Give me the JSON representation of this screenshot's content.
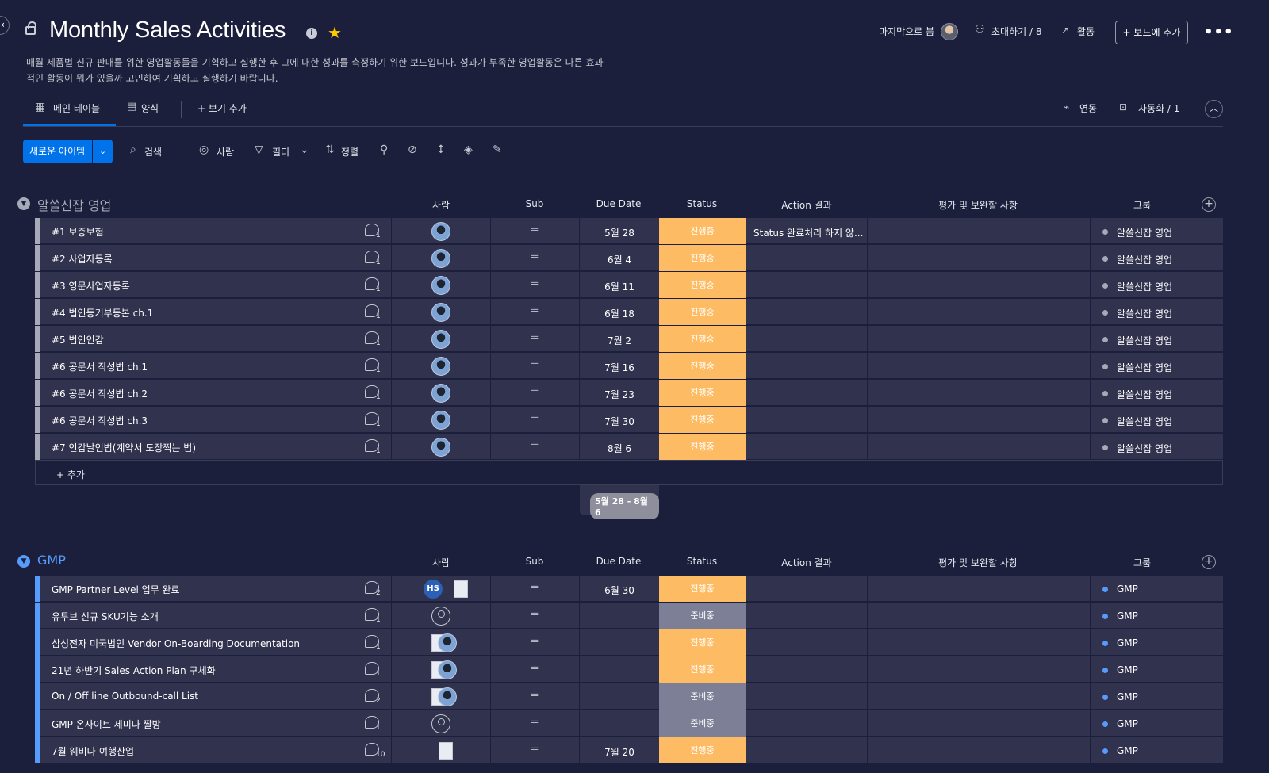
{
  "board": {
    "title": "Monthly Sales Activities",
    "description_line1": "매월 제품별 신규 판매를 위한 영업활동들을 기획하고 실행한 후 그에 대한 성과를 측정하기 위한 보드입니다. 성과가 부족한 영업활동은 다른 효과",
    "description_line2": "적인 활동이 뭐가 있을까 고민하여 기획하고 실행하기 바랍니다."
  },
  "header": {
    "last_seen": "마지막으로 봄",
    "invite": "초대하기 / 8",
    "activity": "활동",
    "add_to_board": "+ 보드에 추가"
  },
  "tabs": {
    "main_table": "메인 테이블",
    "form": "양식",
    "add_view": "+ 보기 추가",
    "integrate": "연동",
    "automate": "자동화 / 1"
  },
  "toolbar": {
    "new_item": "새로운 아이템",
    "search": "검색",
    "person": "사람",
    "filter": "필터",
    "sort": "정렬"
  },
  "columns": {
    "person": "사람",
    "sub": "Sub",
    "due": "Due Date",
    "status": "Status",
    "action": "Action 결과",
    "eval": "평가 및 보완할 사항",
    "group": "그룹"
  },
  "groups": [
    {
      "name": "알쓸신잡 영업",
      "color": "#a6a9b8",
      "add_label": "+ 추가",
      "date_range": "5월 28 - 8월 6",
      "rows": [
        {
          "name": "#1 보증보험",
          "updates": "1",
          "due": "5월 28",
          "status": "진행중",
          "action": "Status 완료처리 하지 않...",
          "group": "알쓸신잡 영업"
        },
        {
          "name": "#2 사업자등록",
          "updates": "1",
          "due": "6월 4",
          "status": "진행중",
          "action": "",
          "group": "알쓸신잡 영업"
        },
        {
          "name": "#3 영문사업자등록",
          "updates": "1",
          "due": "6월 11",
          "status": "진행중",
          "action": "",
          "group": "알쓸신잡 영업"
        },
        {
          "name": "#4 법인등기부등본 ch.1",
          "updates": "1",
          "due": "6월 18",
          "status": "진행중",
          "action": "",
          "group": "알쓸신잡 영업"
        },
        {
          "name": "#5 법인인감",
          "updates": "1",
          "due": "7월 2",
          "status": "진행중",
          "action": "",
          "group": "알쓸신잡 영업"
        },
        {
          "name": "#6 공문서 작성법 ch.1",
          "updates": "1",
          "due": "7월 16",
          "status": "진행중",
          "action": "",
          "group": "알쓸신잡 영업"
        },
        {
          "name": "#6 공문서 작성법 ch.2",
          "updates": "1",
          "due": "7월 23",
          "status": "진행중",
          "action": "",
          "group": "알쓸신잡 영업"
        },
        {
          "name": "#6 공문서 작성법 ch.3",
          "updates": "1",
          "due": "7월 30",
          "status": "진행중",
          "action": "",
          "group": "알쓸신잡 영업"
        },
        {
          "name": "#7 인감날인법(계약서 도장찍는 법)",
          "updates": "1",
          "due": "8월 6",
          "status": "진행중",
          "action": "",
          "group": "알쓸신잡 영업"
        }
      ]
    },
    {
      "name": "GMP",
      "color": "#579bfc",
      "rows": [
        {
          "name": "GMP Partner Level 업무 완료",
          "updates": "2",
          "due": "6월 30",
          "status": "진행중",
          "group": "GMP"
        },
        {
          "name": "유투브 신규 SKU기능 소개",
          "updates": "1",
          "due": "",
          "status": "준비중",
          "group": "GMP"
        },
        {
          "name": "삼성전자 미국법인 Vendor On-Boarding Documentation",
          "updates": "1",
          "due": "",
          "status": "진행중",
          "group": "GMP"
        },
        {
          "name": "21년 하반기 Sales Action Plan 구체화",
          "updates": "1",
          "due": "",
          "status": "진행중",
          "group": "GMP"
        },
        {
          "name": "On / Off line Outbound-call List",
          "updates": "2",
          "due": "",
          "status": "준비중",
          "group": "GMP"
        },
        {
          "name": "GMP 온사이트 세미나 짤방",
          "updates": "1",
          "due": "",
          "status": "준비중",
          "group": "GMP"
        },
        {
          "name": "7월 웨비나-여행산업",
          "updates": "10",
          "due": "7월 20",
          "status": "진행중",
          "group": "GMP"
        }
      ]
    }
  ],
  "status_colors": {
    "진행중": "#fdbc64",
    "준비중": "#7c7f96"
  },
  "hs_initials": "HS"
}
